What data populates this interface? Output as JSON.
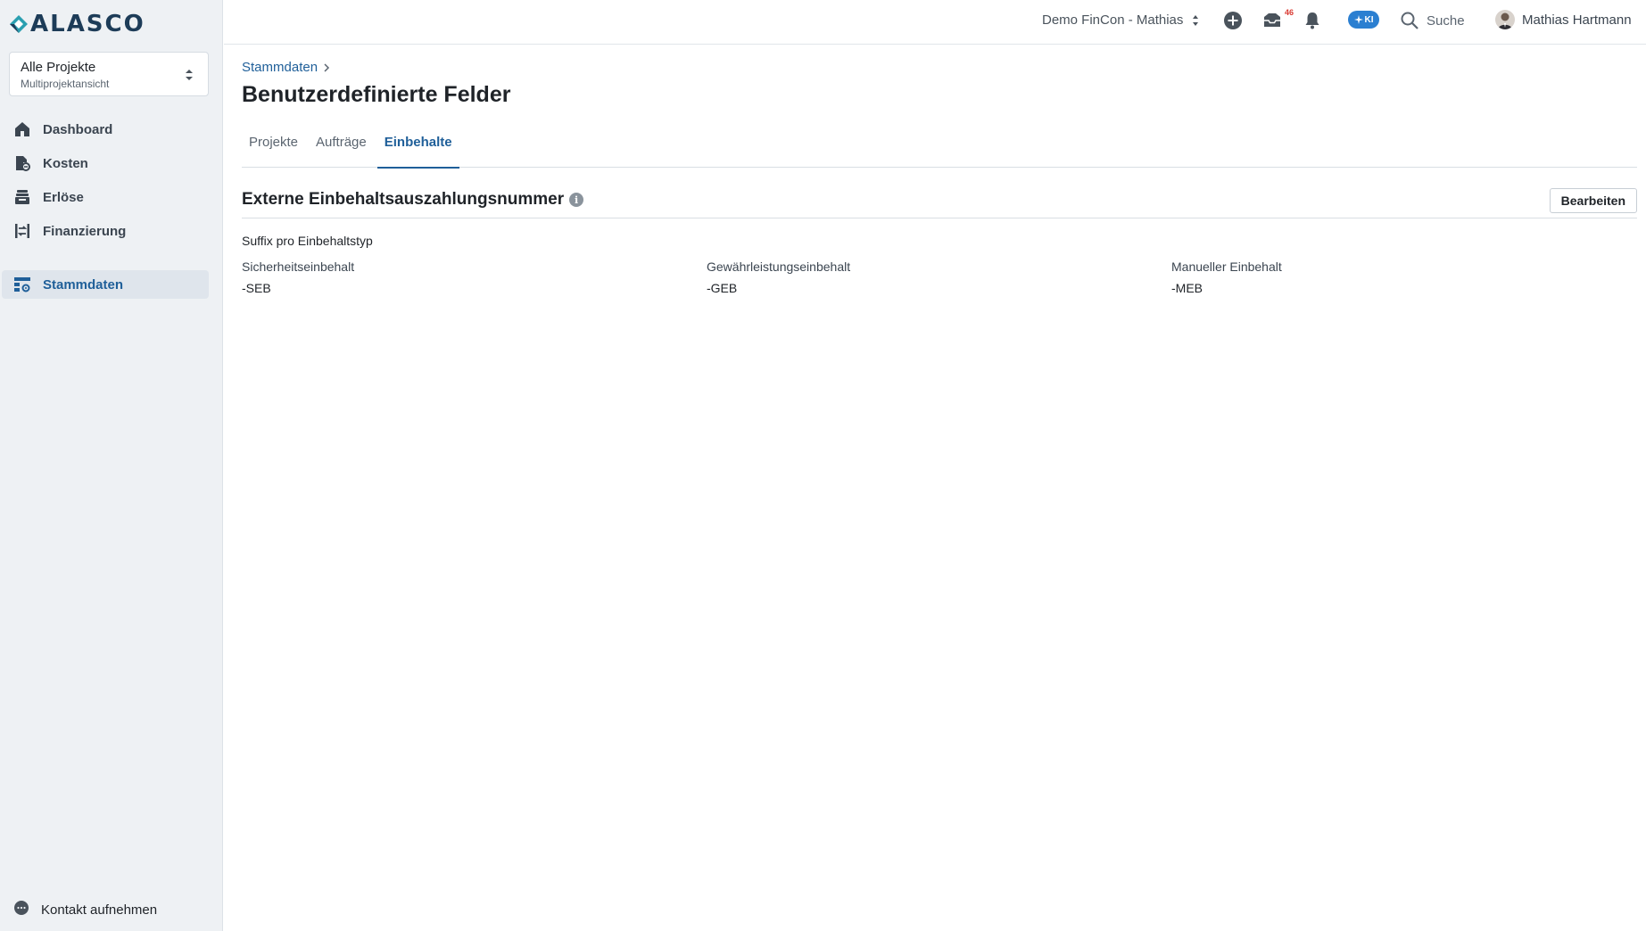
{
  "app": {
    "logo_text": "ALASCO",
    "brand_color": "#1d3c58",
    "accent_color": "#1f5f99"
  },
  "sidebar": {
    "project_select": {
      "title": "Alle Projekte",
      "subtitle": "Multiprojektansicht"
    },
    "items": [
      {
        "label": "Dashboard",
        "icon": "home-icon"
      },
      {
        "label": "Kosten",
        "icon": "cost-icon"
      },
      {
        "label": "Erlöse",
        "icon": "revenue-icon"
      },
      {
        "label": "Finanzierung",
        "icon": "financing-icon"
      },
      {
        "label": "Stammdaten",
        "icon": "master-data-icon",
        "active": true
      }
    ],
    "contact_label": "Kontakt aufnehmen"
  },
  "header": {
    "tenant": "Demo FinCon - Mathias",
    "inbox_count": "46",
    "ki_label": "KI",
    "search_label": "Suche",
    "user_name": "Mathias Hartmann"
  },
  "main": {
    "breadcrumb": "Stammdaten",
    "title": "Benutzerdefinierte Felder",
    "tabs": [
      {
        "label": "Projekte"
      },
      {
        "label": "Aufträge"
      },
      {
        "label": "Einbehalte",
        "active": true
      }
    ],
    "section": {
      "title": "Externe Einbehaltsauszahlungsnummer",
      "edit_label": "Bearbeiten",
      "subheading": "Suffix pro Einbehaltstyp",
      "fields": [
        {
          "label": "Sicherheitseinbehalt",
          "value": "-SEB"
        },
        {
          "label": "Gewährleistungseinbehalt",
          "value": "-GEB"
        },
        {
          "label": "Manueller Einbehalt",
          "value": "-MEB"
        }
      ]
    }
  }
}
